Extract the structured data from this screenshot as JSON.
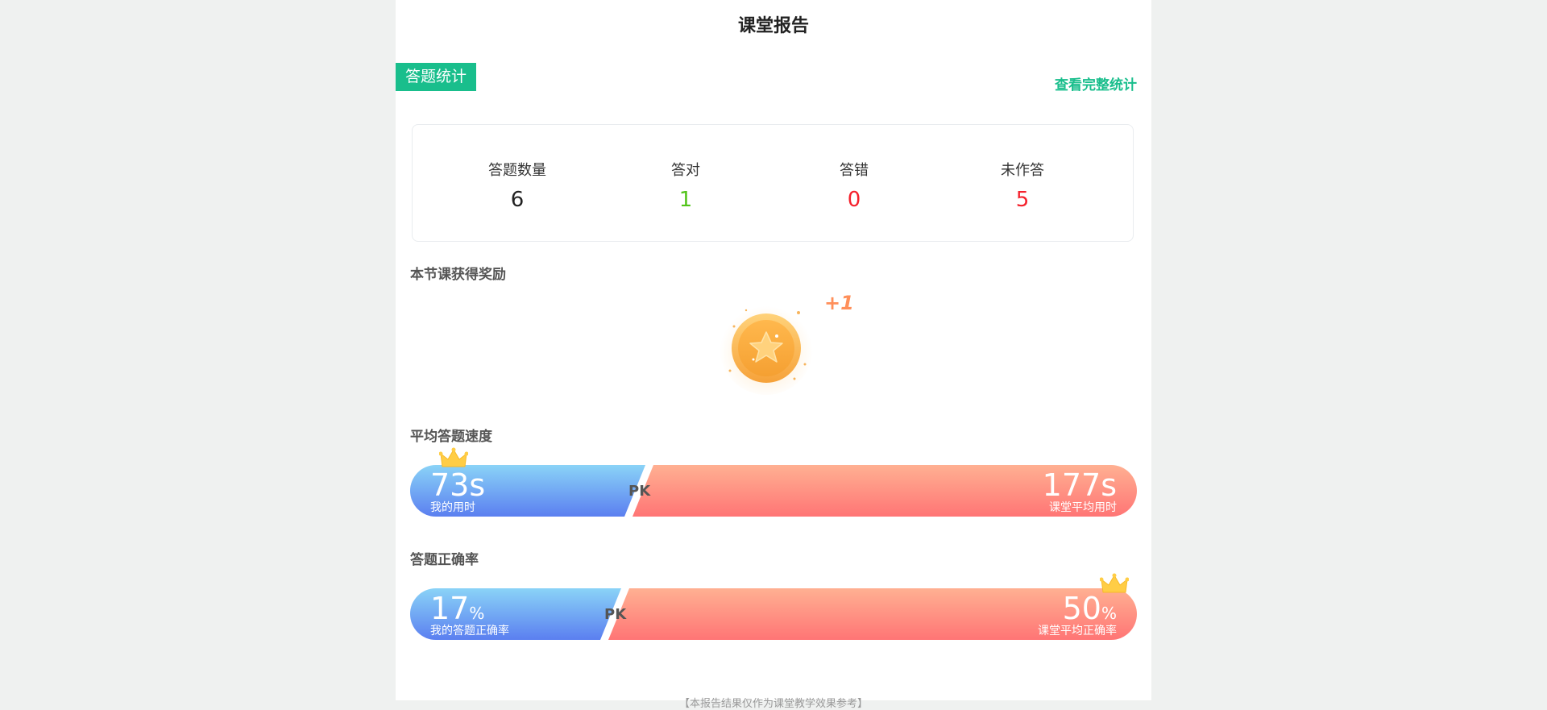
{
  "header": {
    "title": "课堂报告"
  },
  "answer_stats": {
    "tag": "答题统计",
    "link": "查看完整统计",
    "items": [
      {
        "label": "答题数量",
        "value": "6"
      },
      {
        "label": "答对",
        "value": "1"
      },
      {
        "label": "答错",
        "value": "0"
      },
      {
        "label": "未作答",
        "value": "5"
      }
    ],
    "colors": {
      "correct": "#52c41a",
      "wrong": "#f5222d",
      "accent": "#19be8c"
    }
  },
  "reward": {
    "title": "本节课获得奖励",
    "bonus": "+1",
    "icon": "star-coin-icon"
  },
  "speed": {
    "title": "平均答题速度",
    "mine_value": "73",
    "mine_unit": "s",
    "mine_label": "我的用时",
    "class_value": "177",
    "class_unit": "s",
    "class_label": "课堂平均用时",
    "pk": "PK",
    "winner": "mine"
  },
  "accuracy": {
    "title": "答题正确率",
    "mine_value": "17",
    "mine_unit": "%",
    "mine_label": "我的答题正确率",
    "class_value": "50",
    "class_unit": "%",
    "class_label": "课堂平均正确率",
    "pk": "PK",
    "winner": "class"
  },
  "footer": {
    "note": "【本报告结果仅作为课堂教学效果参考】"
  }
}
